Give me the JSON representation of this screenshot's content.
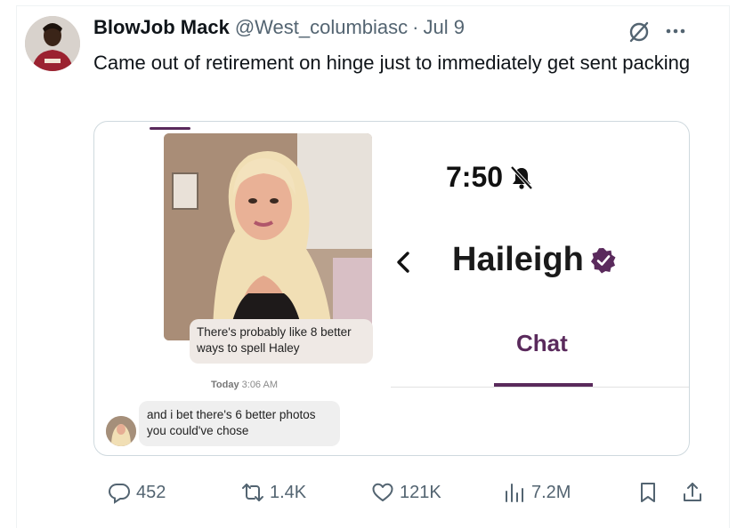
{
  "tweet": {
    "author_name": "BlowJob Mack",
    "author_handle": "@West_columbiasc",
    "separator": "·",
    "date": "Jul 9",
    "text": "Came out of retirement on hinge just to immediately get sent packing"
  },
  "screenshot": {
    "incoming_message": "There's probably like 8 better ways to spell Haley",
    "timestamp_day": "Today",
    "timestamp_time": "3:06 AM",
    "outgoing_message": "and i bet there's 6 better photos you could've chose",
    "phone_time": "7:50",
    "match_name": "Haileigh",
    "active_tab": "Chat"
  },
  "actions": {
    "replies": "452",
    "retweets": "1.4K",
    "likes": "121K",
    "views": "7.2M"
  },
  "colors": {
    "hinge_purple": "#5a2a5c",
    "muted_text": "#536471",
    "border": "#cfd9de"
  },
  "icons": [
    "grok-icon",
    "more-icon",
    "bell-off-icon",
    "back-chevron-icon",
    "verified-icon",
    "reply-icon",
    "retweet-icon",
    "like-icon",
    "views-icon",
    "bookmark-icon",
    "share-icon"
  ]
}
